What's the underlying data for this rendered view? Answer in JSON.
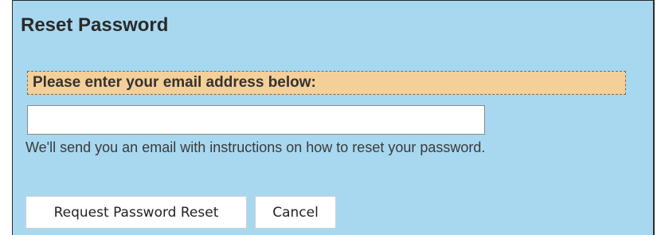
{
  "panel": {
    "title": "Reset Password",
    "prompt": "Please enter your email address below:",
    "email": {
      "value": "",
      "placeholder": ""
    },
    "hint": "We'll send you an email with instructions on how to reset your password.",
    "buttons": {
      "request_reset": "Request Password Reset",
      "cancel": "Cancel"
    }
  },
  "colors": {
    "panel_background": "#a8d8f0",
    "prompt_highlight": "#f5cf98",
    "border": "#2a2a2a"
  }
}
